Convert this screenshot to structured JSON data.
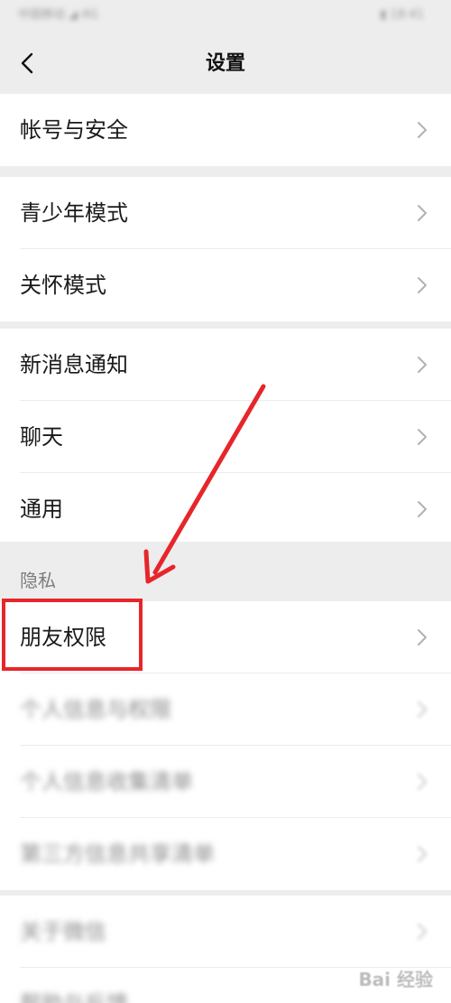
{
  "status_bar": {
    "left_text": "中国移动 ◢ 4G",
    "right_text": "▮ 18:41"
  },
  "nav": {
    "title": "设置"
  },
  "groups": [
    {
      "items": [
        {
          "label": "帐号与安全"
        }
      ]
    },
    {
      "items": [
        {
          "label": "青少年模式"
        },
        {
          "label": "关怀模式"
        }
      ]
    },
    {
      "items": [
        {
          "label": "新消息通知"
        },
        {
          "label": "聊天"
        },
        {
          "label": "通用"
        }
      ]
    }
  ],
  "privacy": {
    "header": "隐私",
    "items": [
      {
        "label": "朋友权限"
      },
      {
        "label": "个人信息与权限"
      },
      {
        "label": "个人信息收集清单"
      },
      {
        "label": "第三方信息共享清单"
      }
    ]
  },
  "bottom_group": {
    "items": [
      {
        "label": "关于微信"
      },
      {
        "label": "帮助与反馈"
      }
    ]
  },
  "annotation": {
    "highlight_color": "#e6262a",
    "arrow_color": "#e6262a"
  },
  "watermark": {
    "text": "Bai 经验"
  }
}
